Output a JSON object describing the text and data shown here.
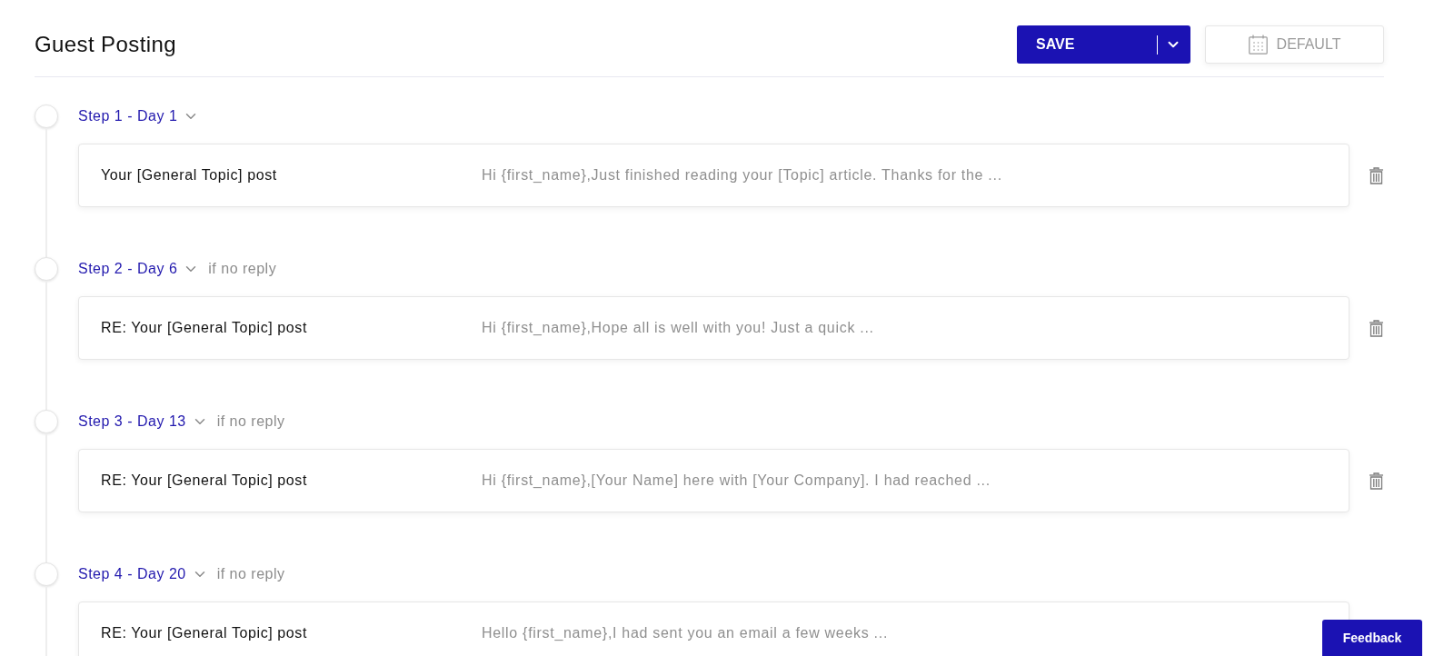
{
  "header": {
    "title": "Guest Posting",
    "save_button": {
      "label": "SAVE"
    },
    "default_button": {
      "label": "DEFAULT"
    }
  },
  "steps": [
    {
      "label": "Step 1 - Day 1",
      "subject": "Your [General Topic] post",
      "preview": "Hi {first_name},Just finished reading your [Topic] article. Thanks for the ...",
      "deletable": true
    },
    {
      "label": "Step 2 - Day 6",
      "condition": "if no reply",
      "subject": "RE: Your [General Topic] post",
      "preview": "Hi {first_name},Hope all is well with you! Just a quick ...",
      "deletable": true
    },
    {
      "label": "Step 3 - Day 13",
      "condition": "if no reply",
      "subject": "RE: Your [General Topic] post",
      "preview": "Hi {first_name},[Your Name] here with [Your Company]. I had reached ...",
      "deletable": true
    },
    {
      "label": "Step 4 - Day 20",
      "condition": "if no reply",
      "subject": "RE: Your [General Topic] post",
      "preview": "Hello {first_name},I had sent you an email a few weeks ...",
      "deletable": false
    }
  ],
  "feedback_button": {
    "label": "Feedback"
  }
}
